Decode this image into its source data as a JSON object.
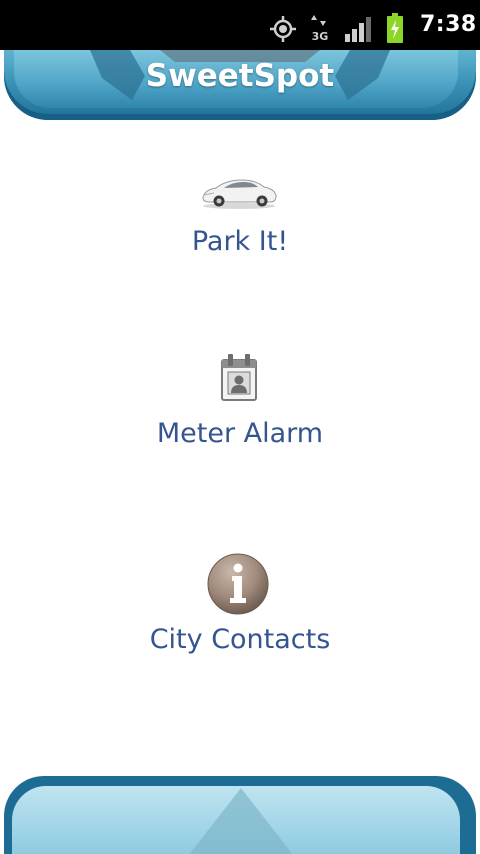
{
  "status_bar": {
    "time": "7:38",
    "network": "3G",
    "icons": [
      "gps-icon",
      "3g-data-icon",
      "signal-icon",
      "battery-charging-icon"
    ]
  },
  "header": {
    "title": "SweetSpot"
  },
  "menu": {
    "items": [
      {
        "label": "Park It!",
        "icon": "car-icon"
      },
      {
        "label": "Meter Alarm",
        "icon": "contact-calendar-icon"
      },
      {
        "label": "City Contacts",
        "icon": "info-icon"
      }
    ]
  },
  "colors": {
    "status_bar_bg": "#000000",
    "header_blue": "#3b93b7",
    "header_dark": "#1f6f96",
    "label_text": "#34558f",
    "footer_light": "#9dd3e6",
    "battery_green": "#8bd629"
  }
}
